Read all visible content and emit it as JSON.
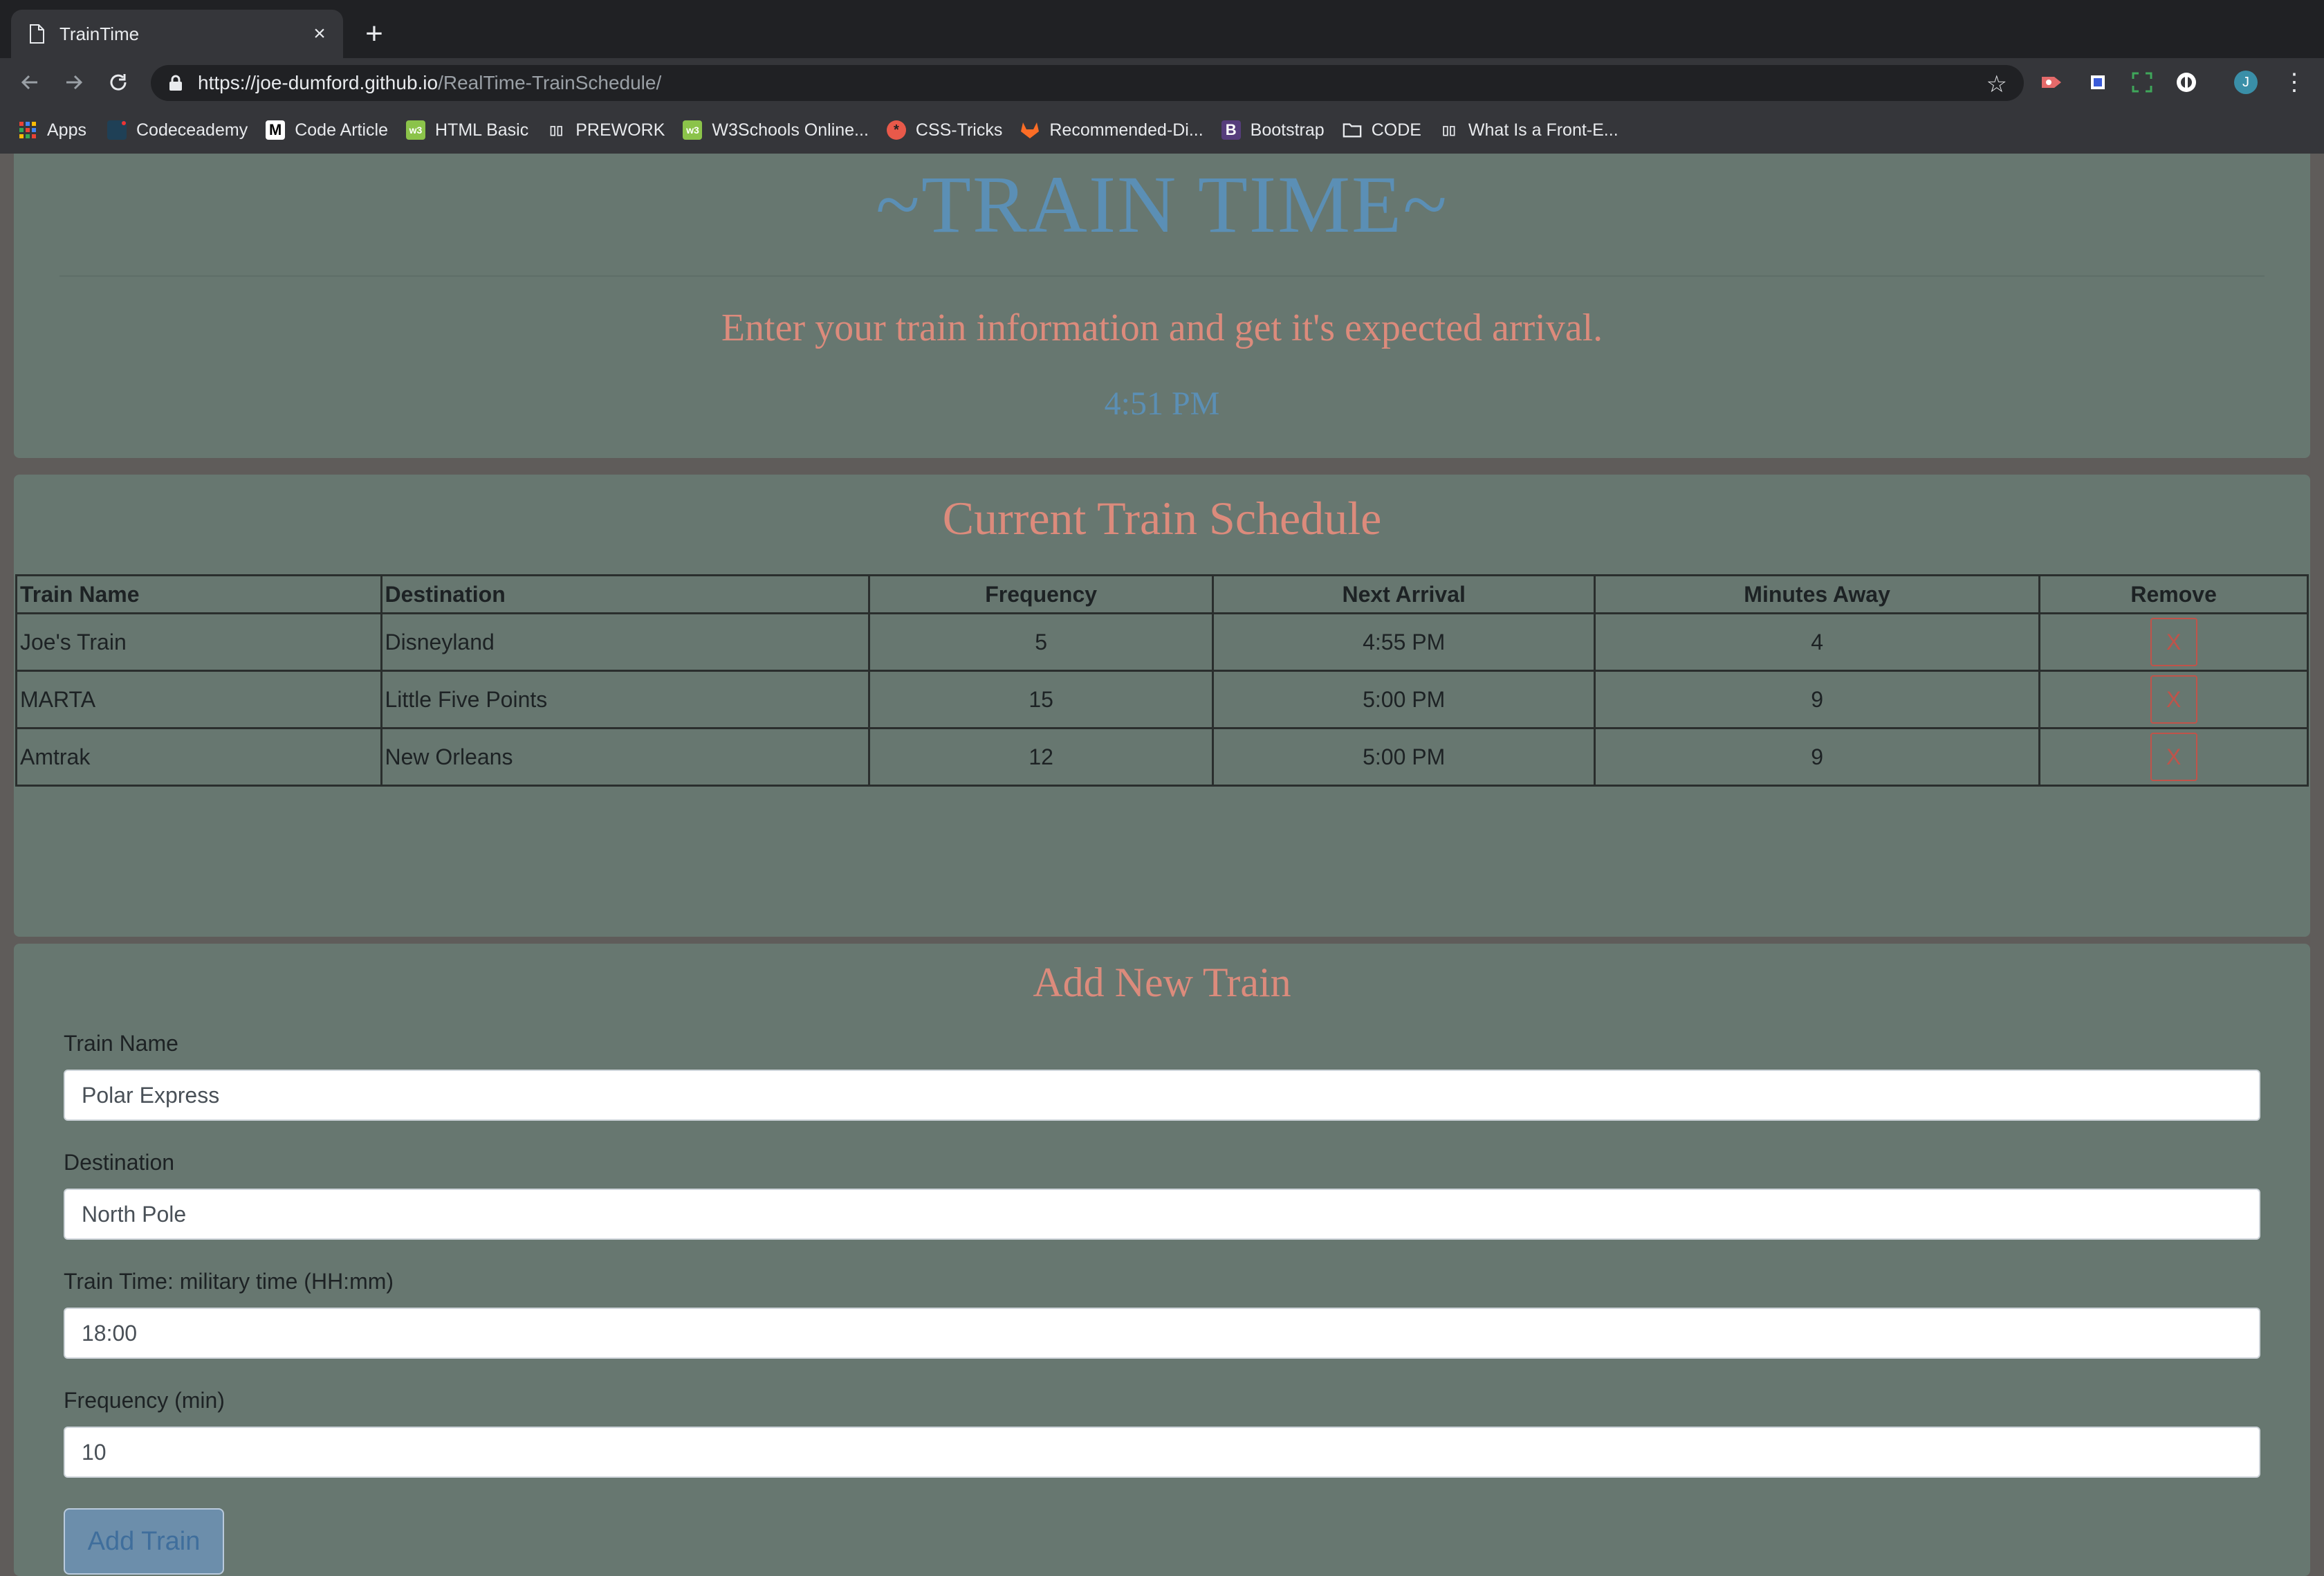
{
  "browser": {
    "tab_title": "TrainTime",
    "tab_close": "×",
    "new_tab": "+",
    "url_host": "https://joe-dumford.github.io",
    "url_path": "/RealTime-TrainSchedule/",
    "profile_initial": "J",
    "bookmarks": [
      {
        "label": "Apps",
        "icon": "apps-grid-icon"
      },
      {
        "label": "Codeceademy",
        "icon": "codecademy-icon"
      },
      {
        "label": "Code Article",
        "icon": "medium-icon"
      },
      {
        "label": "HTML Basic",
        "icon": "w3schools-icon"
      },
      {
        "label": "PREWORK",
        "icon": "book-icon"
      },
      {
        "label": "W3Schools Online...",
        "icon": "w3schools-icon"
      },
      {
        "label": "CSS-Tricks",
        "icon": "css-tricks-icon"
      },
      {
        "label": "Recommended-Di...",
        "icon": "gitlab-icon"
      },
      {
        "label": "Bootstrap",
        "icon": "bootstrap-icon"
      },
      {
        "label": "CODE",
        "icon": "folder-icon"
      },
      {
        "label": "What Is a Front-E...",
        "icon": "book-icon"
      }
    ]
  },
  "header": {
    "title": "~TRAIN TIME~",
    "lead": "Enter your train information and get it's expected arrival.",
    "clock": "4:51 PM"
  },
  "schedule": {
    "title": "Current Train Schedule",
    "columns": [
      "Train Name",
      "Destination",
      "Frequency",
      "Next Arrival",
      "Minutes Away",
      "Remove"
    ],
    "rows": [
      {
        "name": "Joe's Train",
        "destination": "Disneyland",
        "frequency": "5",
        "next_arrival": "4:55 PM",
        "minutes_away": "4",
        "remove": "X"
      },
      {
        "name": "MARTA",
        "destination": "Little Five Points",
        "frequency": "15",
        "next_arrival": "5:00 PM",
        "minutes_away": "9",
        "remove": "X"
      },
      {
        "name": "Amtrak",
        "destination": "New Orleans",
        "frequency": "12",
        "next_arrival": "5:00 PM",
        "minutes_away": "9",
        "remove": "X"
      }
    ]
  },
  "form": {
    "title": "Add New Train",
    "fields": [
      {
        "label": "Train Name",
        "value": "Polar Express"
      },
      {
        "label": "Destination",
        "value": "North Pole"
      },
      {
        "label": "Train Time: military time (HH:mm)",
        "value": "18:00"
      },
      {
        "label": "Frequency (min)",
        "value": "10"
      }
    ],
    "submit_label": "Add Train"
  },
  "colors": {
    "panel": "#677770",
    "page_bg": "#5f5c5a",
    "title_blue": "#5b8fb5",
    "accent_salmon": "#dc8b7c",
    "remove_red": "#c0534a"
  }
}
